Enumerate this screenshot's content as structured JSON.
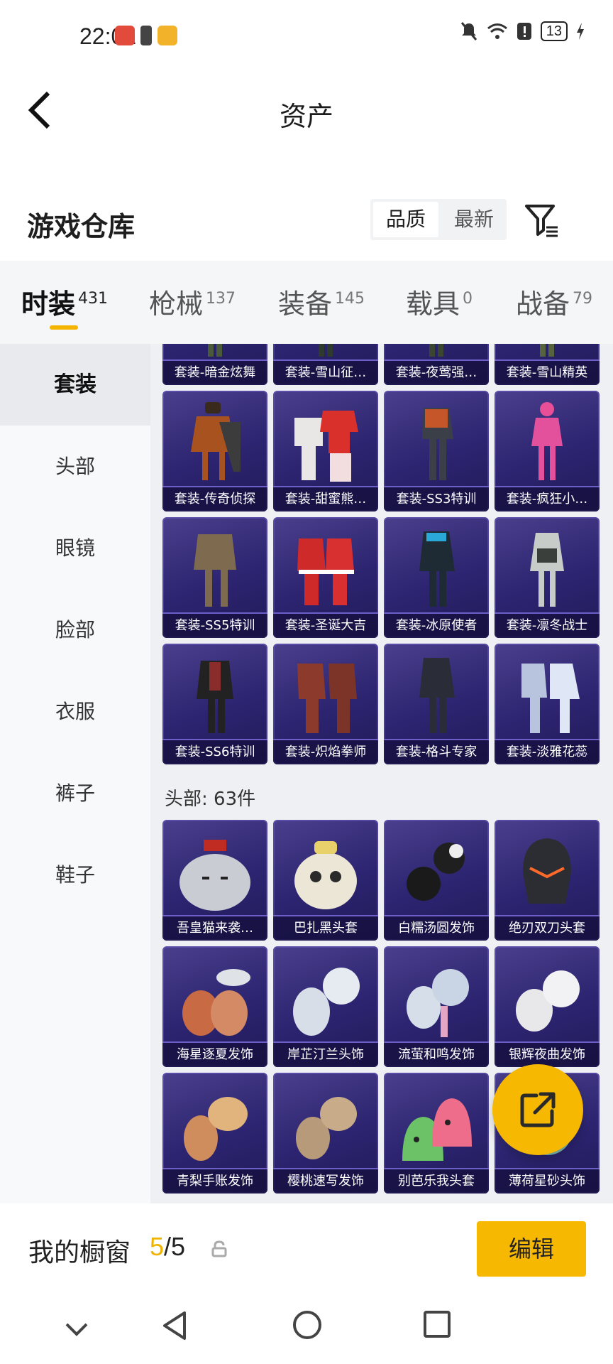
{
  "status": {
    "time": "22:01",
    "battery": "13"
  },
  "header": {
    "title": "资产"
  },
  "section": {
    "title": "游戏仓库",
    "sort_options": [
      "品质",
      "最新"
    ]
  },
  "tabs": [
    {
      "label": "时装",
      "count": "431",
      "active": true
    },
    {
      "label": "枪械",
      "count": "137"
    },
    {
      "label": "装备",
      "count": "145"
    },
    {
      "label": "载具",
      "count": "0"
    },
    {
      "label": "战备",
      "count": "79"
    }
  ],
  "sidebar": [
    "套装",
    "头部",
    "眼镜",
    "脸部",
    "衣服",
    "裤子",
    "鞋子"
  ],
  "suits_top": [
    "套装-暗金炫舞",
    "套装-雪山征…",
    "套装-夜莺强…",
    "套装-雪山精英"
  ],
  "suits": [
    "套装-传奇侦探",
    "套装-甜蜜熊…",
    "套装-SS3特训",
    "套装-疯狂小…",
    "套装-SS5特训",
    "套装-圣诞大吉",
    "套装-冰原使者",
    "套装-凛冬战士",
    "套装-SS6特训",
    "套装-炽焰拳师",
    "套装-格斗专家",
    "套装-淡雅花蕊"
  ],
  "head_section": {
    "title": "头部: 63件"
  },
  "heads": [
    "吾皇猫来袭…",
    "巴扎黑头套",
    "白糯汤圆发饰",
    "绝刃双刀头套",
    "海星逐夏发饰",
    "岸芷汀兰头饰",
    "流萤和鸣发饰",
    "银辉夜曲发饰",
    "青梨手账发饰",
    "樱桃速写发饰",
    "别芭乐我头套",
    "薄荷星砂头饰"
  ],
  "showcase": {
    "label": "我的橱窗",
    "current": "5",
    "total": "/5",
    "edit_label": "编辑"
  },
  "colors": {
    "accent": "#f6b800",
    "card_bg": "#2c2470"
  },
  "icons": [
    "back-arrow-icon",
    "filter-icon",
    "share-external-icon",
    "lock-icon",
    "nav-back-icon",
    "nav-home-icon",
    "nav-recents-icon",
    "nav-collapse-icon"
  ]
}
